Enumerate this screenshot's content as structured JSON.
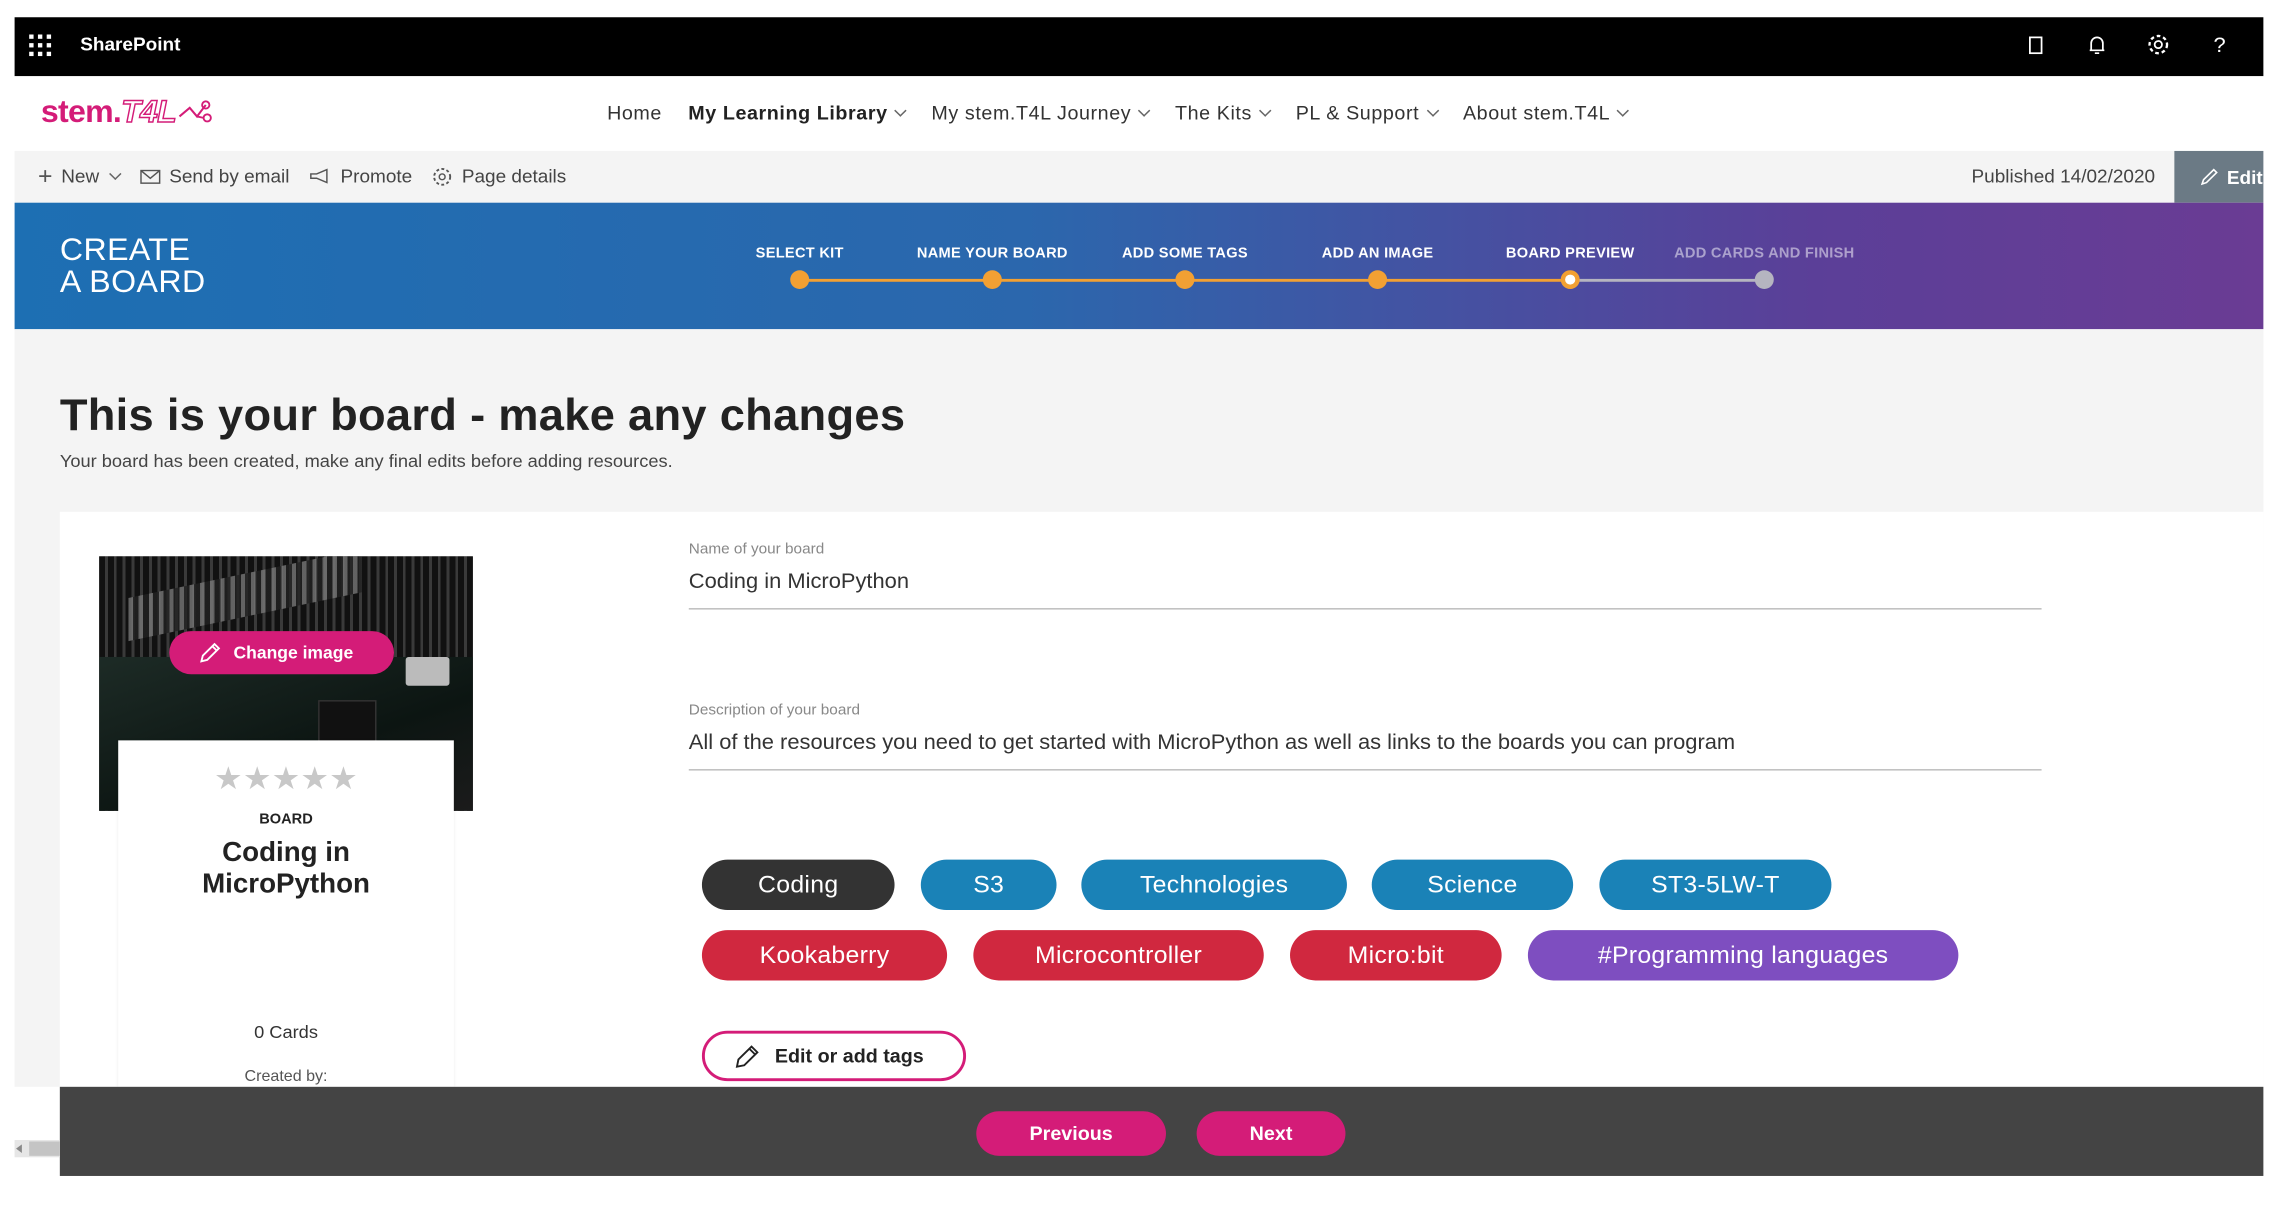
{
  "suite_bar": {
    "app_name": "SharePoint"
  },
  "site": {
    "logo_text_a": "stem.",
    "logo_text_b": "T4L",
    "nav": [
      {
        "label": "Home",
        "has_menu": false,
        "bold": false
      },
      {
        "label": "My Learning Library",
        "has_menu": true,
        "bold": true
      },
      {
        "label": "My stem.T4L Journey",
        "has_menu": true,
        "bold": false
      },
      {
        "label": "The Kits",
        "has_menu": true,
        "bold": false
      },
      {
        "label": "PL & Support",
        "has_menu": true,
        "bold": false
      },
      {
        "label": "About stem.T4L",
        "has_menu": true,
        "bold": false
      }
    ]
  },
  "command_bar": {
    "new_label": "New",
    "send_label": "Send by email",
    "promote_label": "Promote",
    "details_label": "Page details",
    "published": "Published 14/02/2020",
    "edit_label": "Edit"
  },
  "banner": {
    "title": "CREATE\nA BOARD",
    "steps": [
      {
        "label": "SELECT KIT",
        "state": "done"
      },
      {
        "label": "NAME YOUR BOARD",
        "state": "done"
      },
      {
        "label": "ADD SOME TAGS",
        "state": "done"
      },
      {
        "label": "ADD AN IMAGE",
        "state": "done"
      },
      {
        "label": "BOARD PREVIEW",
        "state": "current"
      },
      {
        "label": "ADD CARDS AND FINISH",
        "state": "todo"
      }
    ]
  },
  "main": {
    "heading": "This is your board - make any changes",
    "subheading": "Your board has been created, make any final edits before adding resources."
  },
  "card": {
    "change_image_label": "Change image",
    "stars": "★★★★★",
    "rating": 0,
    "type": "BOARD",
    "title": "Coding in\nMicroPython",
    "cards_count": "0 Cards",
    "created_by": "Created by:"
  },
  "form": {
    "name_label": "Name of your board",
    "name_value": "Coding in MicroPython",
    "desc_label": "Description of your board",
    "desc_value": "All of the resources you need to get started with MicroPython as well as links to the boards you can program"
  },
  "tags": [
    {
      "label": "Coding",
      "color": "dark"
    },
    {
      "label": "S3",
      "color": "blue"
    },
    {
      "label": "Technologies",
      "color": "blue"
    },
    {
      "label": "Science",
      "color": "blue"
    },
    {
      "label": "ST3-5LW-T",
      "color": "blue"
    },
    {
      "label": "Kookaberry",
      "color": "red"
    },
    {
      "label": "Microcontroller",
      "color": "red"
    },
    {
      "label": "Micro:bit",
      "color": "red"
    },
    {
      "label": "#Programming languages",
      "color": "purple"
    }
  ],
  "edit_tags_label": "Edit or add tags",
  "footer": {
    "previous_label": "Previous",
    "next_label": "Next"
  },
  "colors": {
    "accent": "#d41c78",
    "step_done": "#f2a033",
    "step_todo": "#b5b5c0",
    "tag_blue": "#1a82b7",
    "tag_red": "#d0283f",
    "tag_purple": "#7e4ec0"
  }
}
